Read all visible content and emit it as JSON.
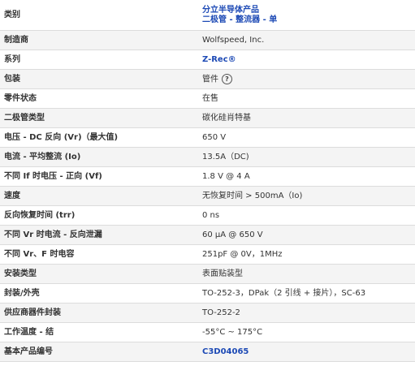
{
  "rows": [
    {
      "label": "类别",
      "value_lines": [
        "分立半导体产品",
        "二极管 - 整流器 - 单"
      ]
    },
    {
      "label": "制造商",
      "value": "Wolfspeed, Inc."
    },
    {
      "label": "系列",
      "value": "Z-Rec®"
    },
    {
      "label": "包装",
      "value": "管件",
      "help_icon": "question-circle-icon",
      "help_glyph": "?"
    },
    {
      "label": "零件状态",
      "value": "在售"
    },
    {
      "label": "二极管类型",
      "value": "碳化硅肖特基"
    },
    {
      "label": "电压 - DC 反向 (Vr)（最大值)",
      "value": "650 V"
    },
    {
      "label": "电流 - 平均整流 (Io)",
      "value": "13.5A（DC)"
    },
    {
      "label": "不同 If 时电压 - 正向 (Vf)",
      "value": "1.8 V @ 4 A"
    },
    {
      "label": "速度",
      "value": "无恢复时间 > 500mA（Io)"
    },
    {
      "label": "反向恢复时间 (trr)",
      "value": "0 ns"
    },
    {
      "label": "不同 Vr 时电流 - 反向泄漏",
      "value": "60 µA @ 650 V"
    },
    {
      "label": "不同 Vr、F 时电容",
      "value": "251pF @ 0V，1MHz"
    },
    {
      "label": "安装类型",
      "value": "表面贴装型"
    },
    {
      "label": "封装/外壳",
      "value": "TO-252-3，DPak（2 引线 + 接片），SC-63"
    },
    {
      "label": "供应商器件封装",
      "value": "TO-252-2"
    },
    {
      "label": "工作温度 - 结",
      "value": "-55°C ~ 175°C"
    },
    {
      "label": "基本产品编号",
      "value": "C3D04065"
    }
  ]
}
